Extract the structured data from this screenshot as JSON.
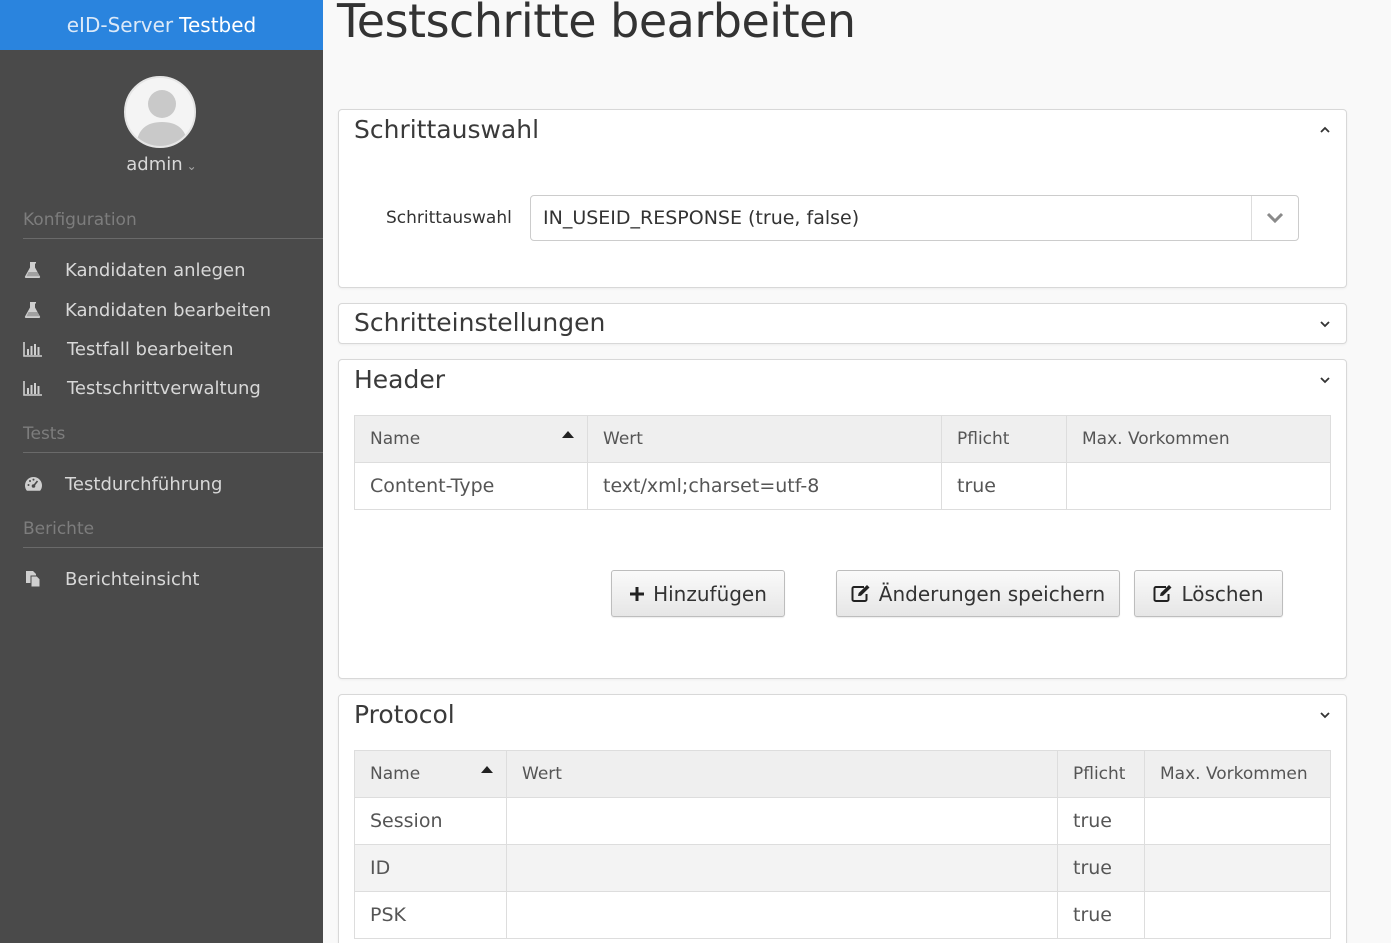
{
  "sidebar": {
    "brand_light": "eID-Server",
    "brand_bold": "Testbed",
    "user": "admin",
    "sections": [
      {
        "title": "Konfiguration"
      },
      {
        "title": "Tests"
      },
      {
        "title": "Berichte"
      }
    ],
    "items": [
      {
        "label": "Kandidaten anlegen",
        "icon": "flask-icon"
      },
      {
        "label": "Kandidaten bearbeiten",
        "icon": "flask-icon"
      },
      {
        "label": "Testfall bearbeiten",
        "icon": "bar-chart-icon"
      },
      {
        "label": "Testschrittverwaltung",
        "icon": "bar-chart-icon"
      },
      {
        "label": "Testdurchführung",
        "icon": "dashboard-icon"
      },
      {
        "label": "Berichteinsicht",
        "icon": "copy-icon"
      }
    ]
  },
  "page": {
    "title": "Testschritte bearbeiten"
  },
  "panels": {
    "step_select": {
      "title": "Schrittauswahl",
      "label": "Schrittauswahl",
      "value": "IN_USEID_RESPONSE (true, false)"
    },
    "step_settings": {
      "title": "Schritteinstellungen"
    },
    "header": {
      "title": "Header",
      "columns": [
        "Name",
        "Wert",
        "Pflicht",
        "Max. Vorkommen"
      ],
      "rows": [
        {
          "name": "Content-Type",
          "value": "text/xml;charset=utf-8",
          "required": "true",
          "max": ""
        }
      ],
      "buttons": {
        "add": "Hinzufügen",
        "save": "Änderungen speichern",
        "delete": "Löschen"
      }
    },
    "protocol": {
      "title": "Protocol",
      "columns": [
        "Name",
        "Wert",
        "Pflicht",
        "Max. Vorkommen"
      ],
      "rows": [
        {
          "name": "Session",
          "value": "",
          "required": "true",
          "max": ""
        },
        {
          "name": "ID",
          "value": "",
          "required": "true",
          "max": ""
        },
        {
          "name": "PSK",
          "value": "",
          "required": "true",
          "max": ""
        }
      ]
    }
  },
  "colors": {
    "brand": "#2a84de",
    "sidebar": "#4a4a4a"
  }
}
